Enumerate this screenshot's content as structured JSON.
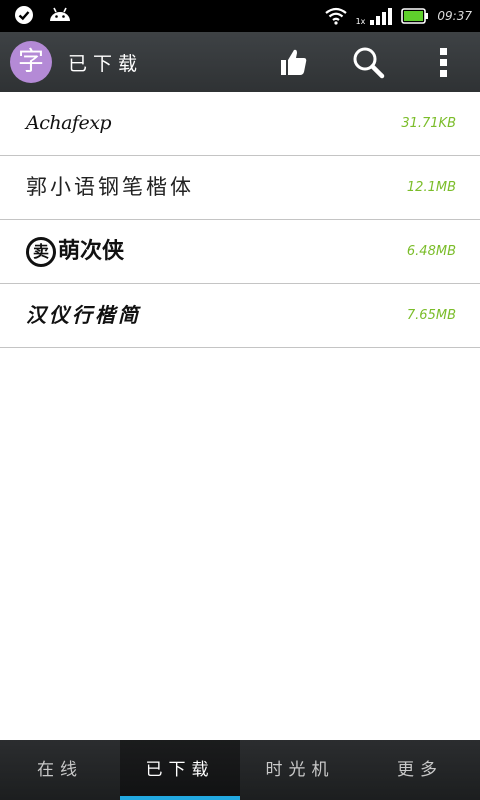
{
  "status_bar": {
    "time": "09:37",
    "network_label": "1x",
    "icons": [
      "check-circle-icon",
      "android-icon",
      "wifi-icon",
      "signal-icon",
      "battery-icon"
    ]
  },
  "action_bar": {
    "logo_char": "字",
    "title": "已下载",
    "icons": [
      "thumbs-up-icon",
      "search-icon",
      "overflow-menu-icon"
    ]
  },
  "font_list": [
    {
      "name": "Achafexp",
      "size": "31.71KB"
    },
    {
      "name": "郭小语钢笔楷体",
      "size": "12.1MB"
    },
    {
      "seal": "卖",
      "name": "萌次侠",
      "size": "6.48MB"
    },
    {
      "name": "汉仪行楷简",
      "size": "7.65MB"
    }
  ],
  "tabs": [
    {
      "label": "在线",
      "active": false
    },
    {
      "label": "已下载",
      "active": true
    },
    {
      "label": "时光机",
      "active": false
    },
    {
      "label": "更多",
      "active": false
    }
  ],
  "colors": {
    "accent": "#22a8e0",
    "size_text": "#7bbd2a",
    "logo": "#b48ad6",
    "action_bar": "#35383a"
  }
}
